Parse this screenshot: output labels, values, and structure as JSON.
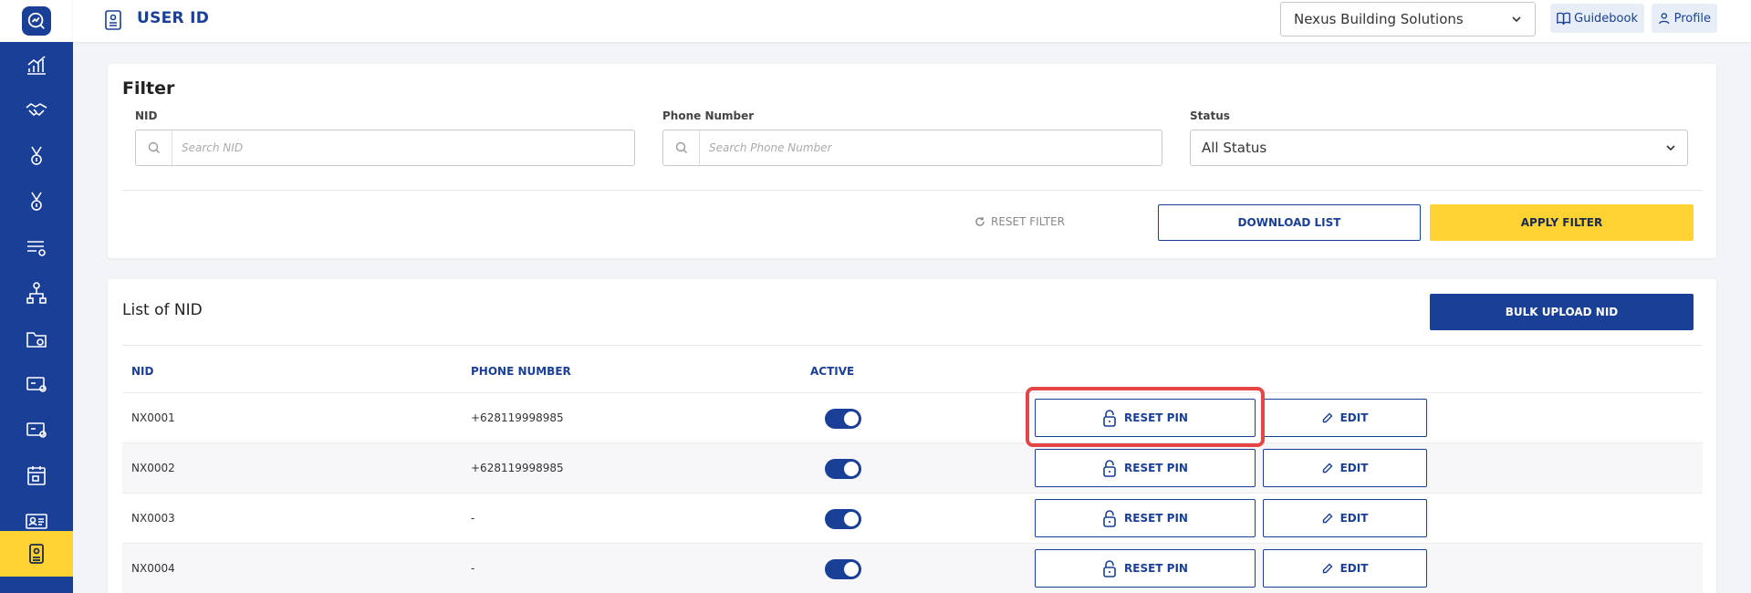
{
  "header": {
    "title": "USER ID",
    "company_selected": "Nexus Building Solutions",
    "guidebook_label": "Guidebook",
    "profile_label": "Profile"
  },
  "sidebar": {
    "items": [
      {
        "icon": "chart-growth-icon"
      },
      {
        "icon": "handshake-icon"
      },
      {
        "icon": "medal-icon"
      },
      {
        "icon": "medal-icon"
      },
      {
        "icon": "list-settings-icon"
      },
      {
        "icon": "hierarchy-icon"
      },
      {
        "icon": "folder-clock-icon"
      },
      {
        "icon": "card-settings-icon"
      },
      {
        "icon": "card-settings-icon"
      },
      {
        "icon": "calendar-icon"
      },
      {
        "icon": "id-card-icon"
      },
      {
        "icon": "user-id-icon",
        "active": true
      }
    ],
    "active_color": "#ffd234",
    "bg_color": "#1a3f96"
  },
  "filter": {
    "title": "Filter",
    "nid_label": "NID",
    "nid_placeholder": "Search NID",
    "phone_label": "Phone Number",
    "phone_placeholder": "Search Phone Number",
    "status_label": "Status",
    "status_selected": "All Status",
    "reset_label": "RESET FILTER",
    "download_label": "DOWNLOAD LIST",
    "apply_label": "APPLY FILTER"
  },
  "list": {
    "title": "List of NID",
    "bulk_upload_label": "BULK UPLOAD NID",
    "columns": [
      "NID",
      "PHONE NUMBER",
      "ACTIVE"
    ],
    "reset_pin_label": "RESET PIN",
    "edit_label": "EDIT",
    "rows": [
      {
        "nid": "NX0001",
        "phone": "+628119998985",
        "active": true
      },
      {
        "nid": "NX0002",
        "phone": "+628119998985",
        "active": true
      },
      {
        "nid": "NX0003",
        "phone": "-",
        "active": true
      },
      {
        "nid": "NX0004",
        "phone": "-",
        "active": true
      }
    ]
  },
  "colors": {
    "primary": "#1a3f96",
    "accent": "#ffd234",
    "highlight": "#e54545"
  }
}
